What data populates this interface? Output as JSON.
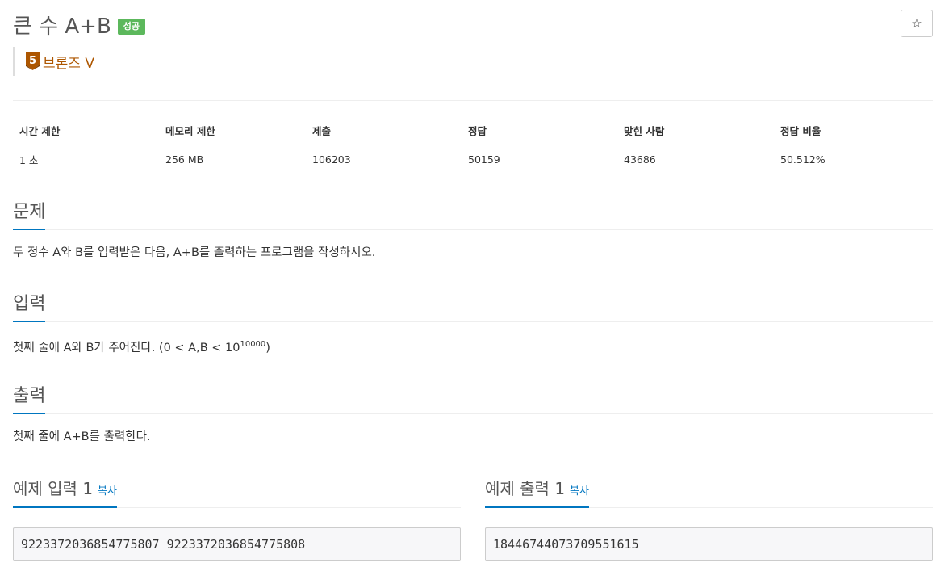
{
  "problem": {
    "title": "큰 수 A+B",
    "status_badge": "성공",
    "star_label": "☆",
    "tier_number": "5",
    "tier": "브론즈 V"
  },
  "info_table": {
    "headers": [
      "시간 제한",
      "메모리 제한",
      "제출",
      "정답",
      "맞힌 사람",
      "정답 비율"
    ],
    "values": [
      "1 초",
      "256 MB",
      "106203",
      "50159",
      "43686",
      "50.512%"
    ]
  },
  "sections": {
    "description": {
      "title": "문제",
      "text": "두 정수 A와 B를 입력받은 다음, A+B를 출력하는 프로그램을 작성하시오."
    },
    "input": {
      "title": "입력",
      "text_before": "첫째 줄에 A와 B가 주어진다. (0 < A,B < 10",
      "sup": "10000",
      "text_after": ")"
    },
    "output": {
      "title": "출력",
      "text": "첫째 줄에 A+B를 출력한다."
    }
  },
  "samples": {
    "input": {
      "title": "예제 입력 1",
      "copy_label": "복사",
      "content": "9223372036854775807 9223372036854775808"
    },
    "output": {
      "title": "예제 출력 1",
      "copy_label": "복사",
      "content": "18446744073709551615"
    }
  },
  "colors": {
    "accent": "#0076c0",
    "success": "#5cb85c",
    "bronze": "#ad5600"
  }
}
